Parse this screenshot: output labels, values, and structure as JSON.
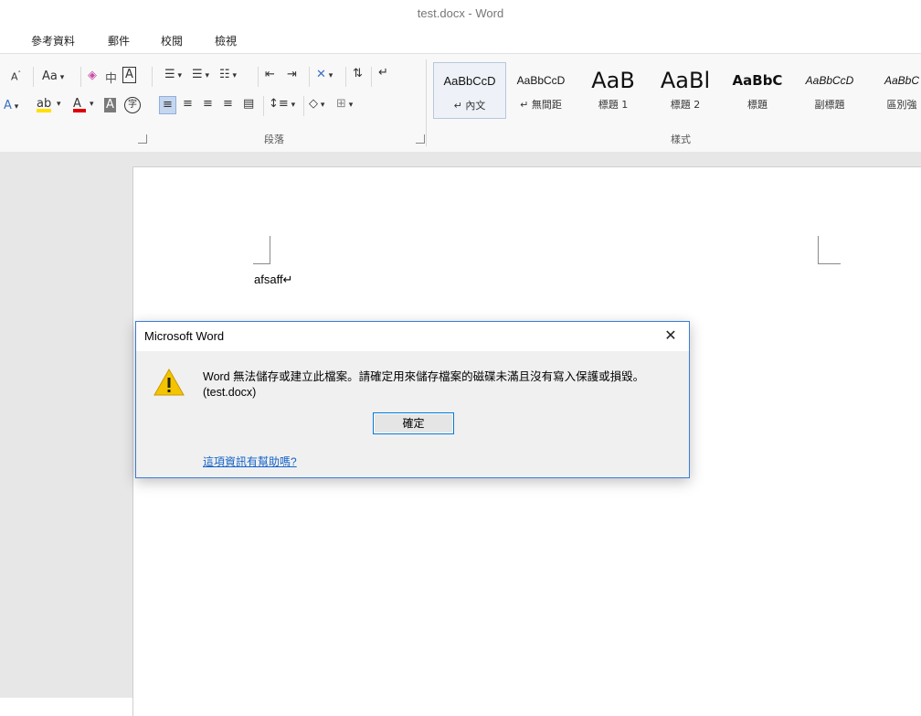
{
  "window": {
    "title": "test.docx - Word"
  },
  "tabs": [
    "參考資料",
    "郵件",
    "校閱",
    "檢視"
  ],
  "ribbon": {
    "font_group": {
      "change_case": "Aa",
      "phonetic": "中",
      "char_border": "A",
      "text_effect": "A",
      "font_color": "A",
      "char_shading": "A",
      "enclose": "字"
    },
    "paragraph_group_label": "段落",
    "styles_group_label": "樣式",
    "styles": [
      {
        "sample": "AaBbCcD",
        "name": "↵ 內文",
        "selected": true,
        "size": 13
      },
      {
        "sample": "AaBbCcD",
        "name": "↵ 無間距",
        "selected": false,
        "size": 12
      },
      {
        "sample": "AaB",
        "name": "標題 1",
        "selected": false,
        "size": 24
      },
      {
        "sample": "AaBl",
        "name": "標題 2",
        "selected": false,
        "size": 24
      },
      {
        "sample": "AaBbC",
        "name": "標題",
        "selected": false,
        "size": 15
      },
      {
        "sample": "AaBbCcD",
        "name": "副標題",
        "selected": false,
        "size": 12
      },
      {
        "sample": "AaBbC",
        "name": "區別強",
        "selected": false,
        "size": 12
      }
    ]
  },
  "document": {
    "text": "afsaff↵"
  },
  "dialog": {
    "title": "Microsoft Word",
    "close": "✕",
    "message_line1": "Word 無法儲存或建立此檔案。請確定用來儲存檔案的磁碟未滿且沒有寫入保護或損毀。",
    "message_line2": "(test.docx)",
    "ok_label": "確定",
    "help_link": "這項資訊有幫助嗎?"
  },
  "colors": {
    "dialog_border": "#3b7ad7",
    "link": "#1463c9",
    "warning": "#f5c400",
    "font_color_bar": "#e00000",
    "highlight_bar": "#ffe000"
  }
}
